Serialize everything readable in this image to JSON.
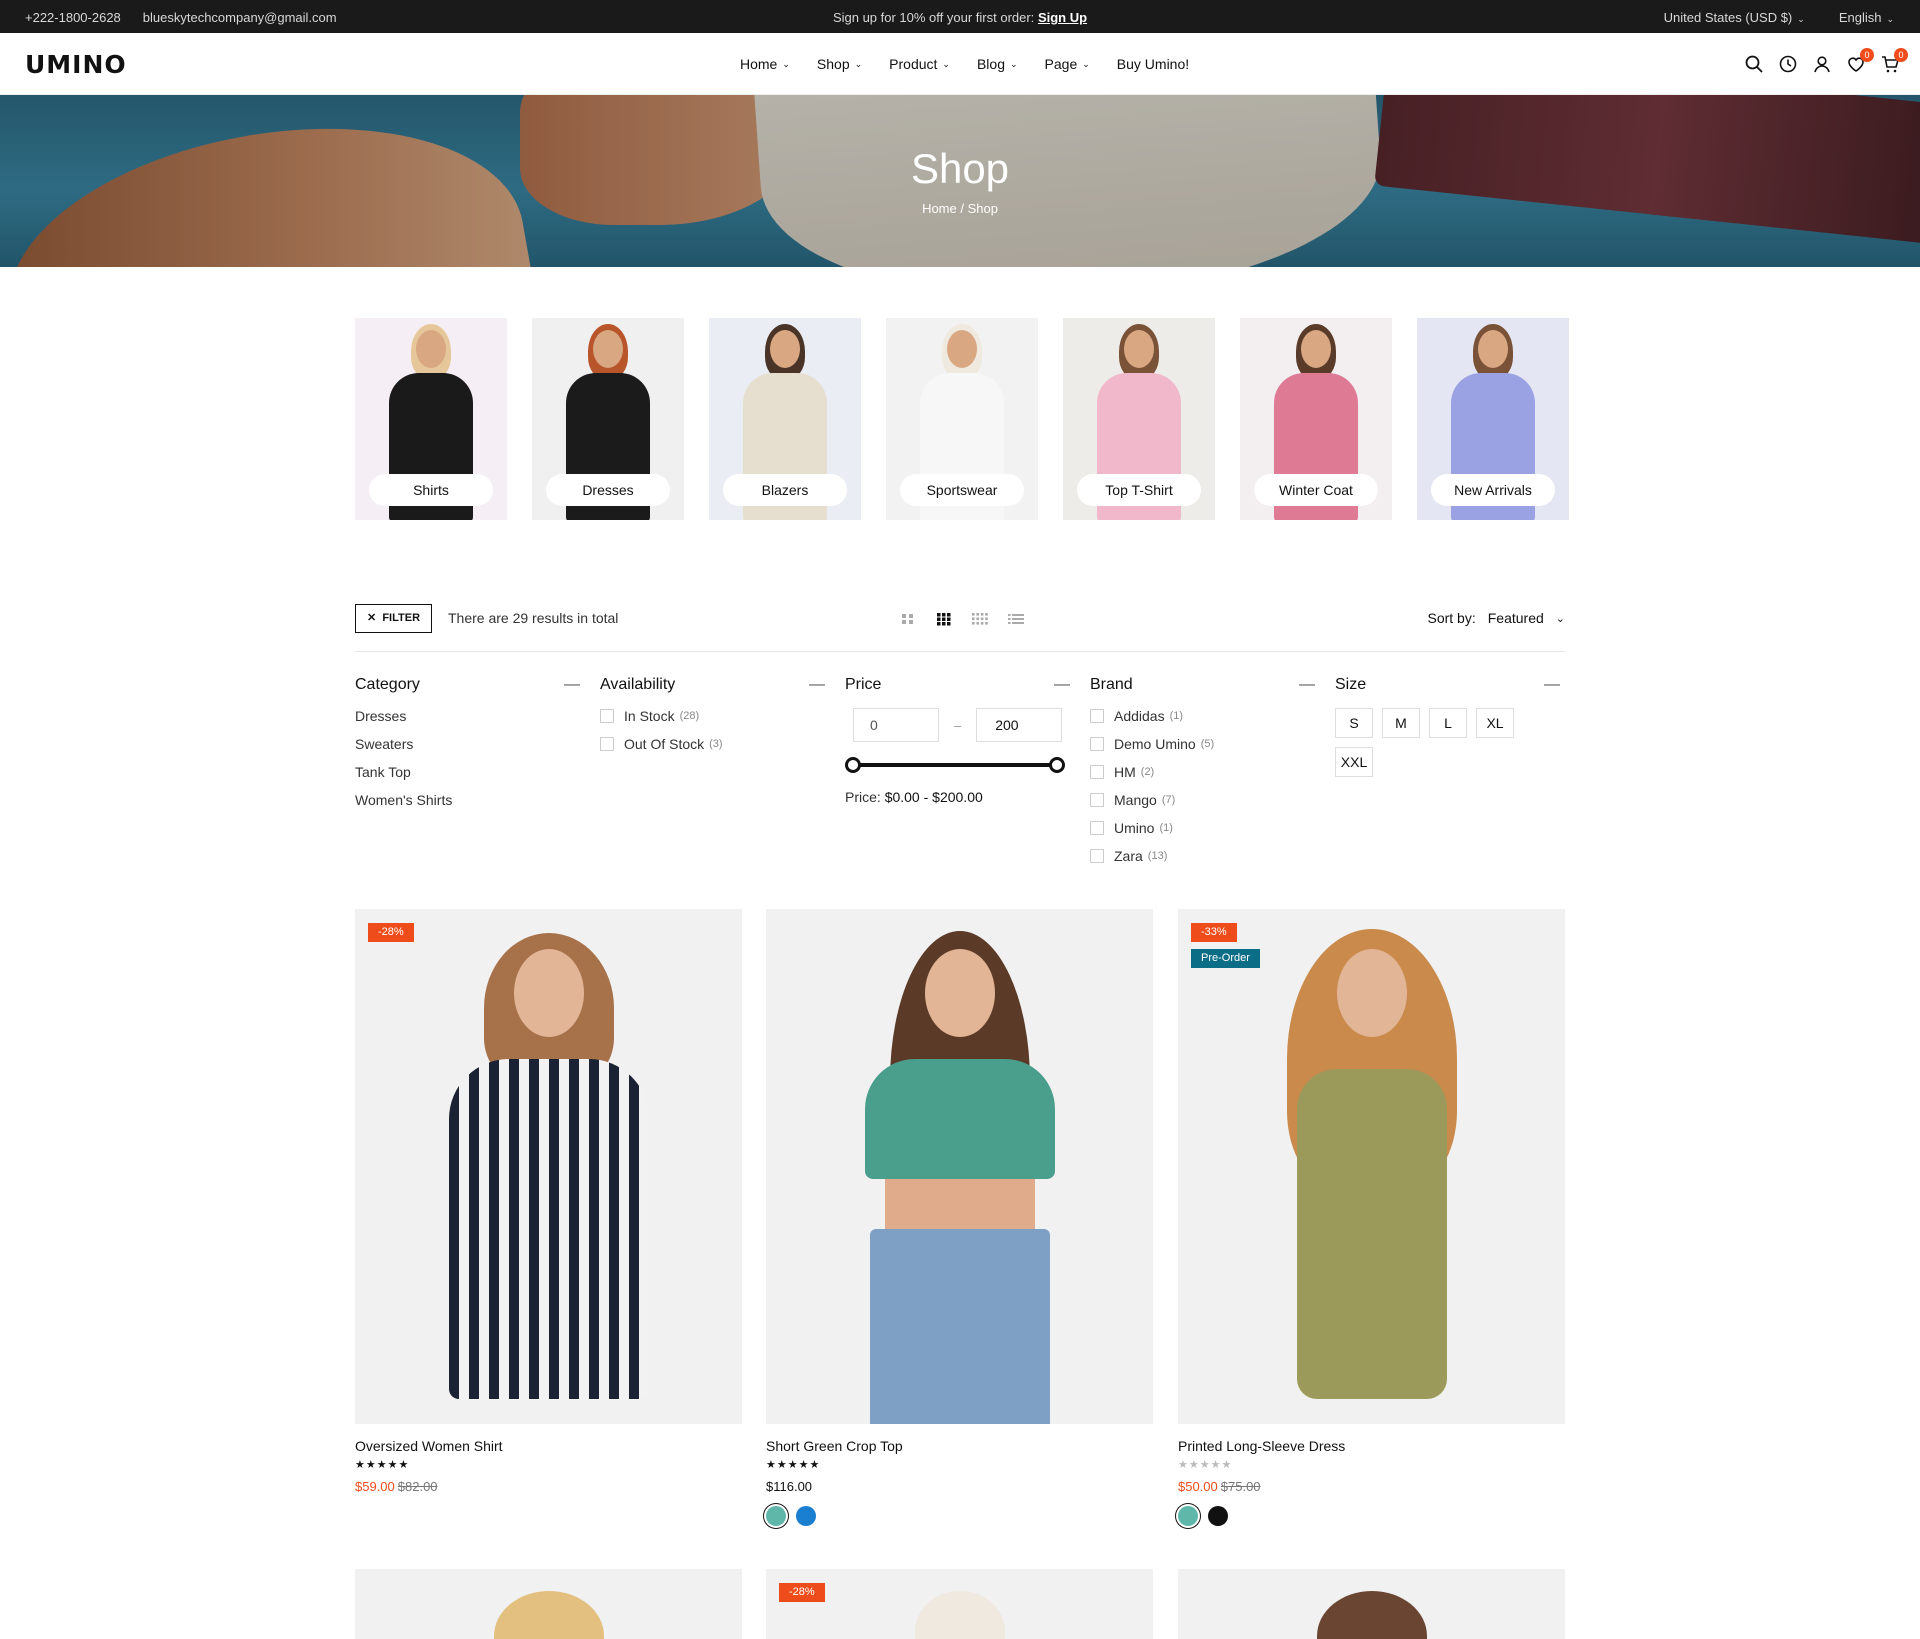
{
  "topbar": {
    "phone": "+222-1800-2628",
    "email": "blueskytechcompany@gmail.com",
    "promo": "Sign up for 10% off your first order:",
    "promo_link": "Sign Up",
    "currency": "United States (USD $)",
    "language": "English"
  },
  "header": {
    "logo": "UMINO",
    "nav": [
      "Home",
      "Shop",
      "Product",
      "Blog",
      "Page",
      "Buy Umino!"
    ],
    "wishlist_count": "0",
    "cart_count": "0"
  },
  "hero": {
    "title": "Shop",
    "breadcrumb": "Home / Shop"
  },
  "categories": [
    {
      "label": "Shirts",
      "bg": "#f6eef5",
      "outfit": "#1a1a1a",
      "hair": "#e6c79a"
    },
    {
      "label": "Dresses",
      "bg": "#f0f0f0",
      "outfit": "#1b1b1b",
      "hair": "#b8552b"
    },
    {
      "label": "Blazers",
      "bg": "#ebedf5",
      "outfit": "#e6dfcf",
      "hair": "#4a3428"
    },
    {
      "label": "Sportswear",
      "bg": "#f2f2f2",
      "outfit": "#f7f7f7",
      "hair": "#efe9e0"
    },
    {
      "label": "Top T-Shirt",
      "bg": "#eeece8",
      "outfit": "#f1b8cc",
      "hair": "#7a5238"
    },
    {
      "label": "Winter Coat",
      "bg": "#f3eef0",
      "outfit": "#df7a95",
      "hair": "#5a3a28"
    },
    {
      "label": "New Arrivals",
      "bg": "#e5e6f4",
      "outfit": "#9aa2e3",
      "hair": "#7a5238"
    }
  ],
  "toolbar": {
    "filter_label": "FILTER",
    "results": "There are 29 results in total",
    "sort_label": "Sort by:",
    "sort_value": "Featured"
  },
  "filters": {
    "category": {
      "title": "Category",
      "items": [
        "Dresses",
        "Sweaters",
        "Tank Top",
        "Women's Shirts"
      ]
    },
    "availability": {
      "title": "Availability",
      "items": [
        {
          "label": "In Stock",
          "count": "(28)"
        },
        {
          "label": "Out Of Stock",
          "count": "(3)"
        }
      ]
    },
    "price": {
      "title": "Price",
      "min": "0",
      "max": "200",
      "sep": "–",
      "label": "Price:",
      "range": "$0.00 - $200.00"
    },
    "brand": {
      "title": "Brand",
      "items": [
        {
          "label": "Addidas",
          "count": "(1)"
        },
        {
          "label": "Demo Umino",
          "count": "(5)"
        },
        {
          "label": "HM",
          "count": "(2)"
        },
        {
          "label": "Mango",
          "count": "(7)"
        },
        {
          "label": "Umino",
          "count": "(1)"
        },
        {
          "label": "Zara",
          "count": "(13)"
        }
      ]
    },
    "size": {
      "title": "Size",
      "items": [
        "S",
        "M",
        "L",
        "XL",
        "XXL"
      ]
    }
  },
  "products": [
    {
      "name": "Oversized Women Shirt",
      "sale": "-28%",
      "price": "$59.00",
      "old": "$82.00",
      "stars": "★★★★★"
    },
    {
      "name": "Short Green Crop Top",
      "price": "$116.00",
      "stars": "★★★★★",
      "swatches": [
        "#5fb7a9",
        "#1a7fd1"
      ]
    },
    {
      "name": "Printed Long-Sleeve Dress",
      "sale": "-33%",
      "preorder": "Pre-Order",
      "price": "$50.00",
      "old": "$75.00",
      "stars": "★★★★★",
      "swatches": [
        "#5fb7a9",
        "#111111"
      ]
    }
  ],
  "products_row2": [
    {
      "sale": ""
    },
    {
      "sale": "-28%"
    },
    {
      "sale": ""
    }
  ]
}
